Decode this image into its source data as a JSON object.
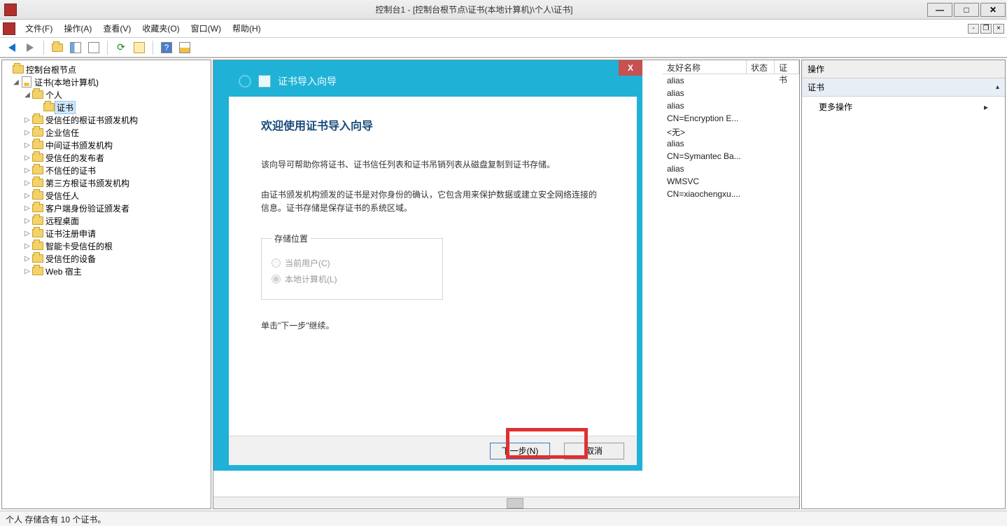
{
  "titlebar": {
    "title": "控制台1 - [控制台根节点\\证书(本地计算机)\\个人\\证书]"
  },
  "winbtns": {
    "min": "—",
    "max": "□",
    "close": "✕"
  },
  "menus": {
    "file": "文件(F)",
    "action": "操作(A)",
    "view": "查看(V)",
    "favorites": "收藏夹(O)",
    "window": "窗口(W)",
    "help": "帮助(H)"
  },
  "mdi": {
    "min": "-",
    "restore": "❐",
    "close": "×"
  },
  "tree": {
    "root": "控制台根节点",
    "cert_root": "证书(本地计算机)",
    "personal": "个人",
    "certs": "证书",
    "nodes": [
      "受信任的根证书颁发机构",
      "企业信任",
      "中间证书颁发机构",
      "受信任的发布者",
      "不信任的证书",
      "第三方根证书颁发机构",
      "受信任人",
      "客户端身份验证颁发者",
      "远程桌面",
      "证书注册申请",
      "智能卡受信任的根",
      "受信任的设备",
      "Web 宿主"
    ]
  },
  "list": {
    "cols": {
      "friendly": "友好名称",
      "status": "状态",
      "cert": "证书"
    },
    "rows": [
      "alias",
      "alias",
      "alias",
      "CN=Encryption E...",
      "<无>",
      "alias",
      "CN=Symantec Ba...",
      "alias",
      "WMSVC",
      "CN=xiaochengxu...."
    ]
  },
  "actions": {
    "header": "操作",
    "section": "证书",
    "more": "更多操作"
  },
  "status": "个人 存储含有 10 个证书。",
  "dialog": {
    "header": "证书导入向导",
    "title": "欢迎使用证书导入向导",
    "p1": "该向导可帮助你将证书、证书信任列表和证书吊销列表从磁盘复制到证书存储。",
    "p2": "由证书颁发机构颁发的证书是对你身份的确认，它包含用来保护数据或建立安全网络连接的信息。证书存储是保存证书的系统区域。",
    "legend": "存储位置",
    "radio_user": "当前用户(C)",
    "radio_machine": "本地计算机(L)",
    "hint": "单击\"下一步\"继续。",
    "next": "下一步(N)",
    "cancel": "取消",
    "close": "X"
  }
}
